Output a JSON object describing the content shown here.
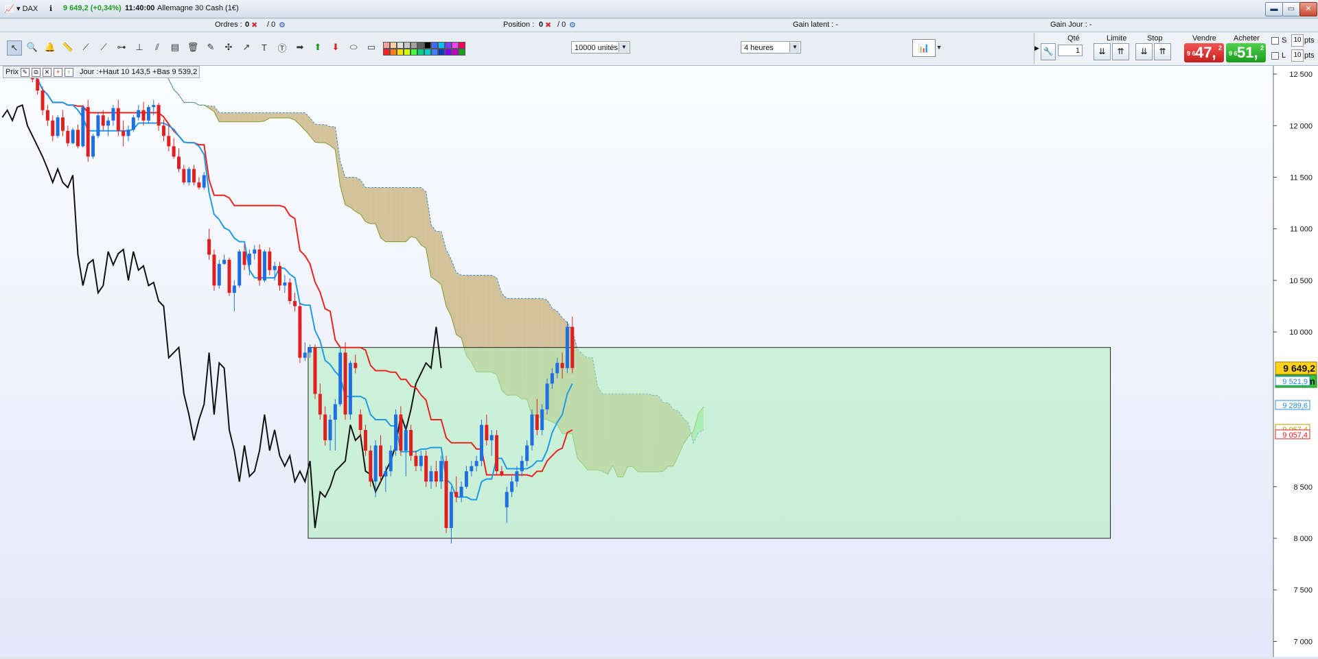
{
  "titlebar": {
    "instrument": "DAX",
    "price_change": "9 649,2 (+0,34%)",
    "time": "11:40:00",
    "market_name": "Allemagne 30 Cash (1€)",
    "window_buttons": [
      "▬",
      "▭",
      "✕"
    ]
  },
  "infobar": {
    "orders_label": "Ordres :",
    "orders_value": "0",
    "orders_sep": "/ 0",
    "position_label": "Position :",
    "position_value": "0",
    "position_sep": "/ 0",
    "latent_label": "Gain latent : -",
    "day_label": "Gain Jour : -"
  },
  "toolbar": {
    "units_select": "10000 unités",
    "period_select": "4 heures"
  },
  "order_panel": {
    "qty_label": "Qté",
    "qty_value": "1",
    "limit_label": "Limite",
    "stop_label": "Stop",
    "sell_label": "Vendre",
    "buy_label": "Acheter",
    "sell_prefix": "9 6",
    "sell_big": "47,",
    "sell_sup": "2",
    "buy_prefix": "9 6",
    "buy_big": "51,",
    "buy_sup": "2",
    "s_label": "S",
    "l_label": "L",
    "s_pts": "10",
    "l_pts": "10",
    "pts_unit": "pts",
    "buy_color": "#23b023",
    "sell_color": "#e03030"
  },
  "legend": {
    "series": "Prix",
    "info": "Jour :+Haut 10 143,5 +Bas 9 539,2"
  },
  "chart_data": {
    "type": "candlestick",
    "y_axis_ticks": [
      "12 500",
      "12 000",
      "11 500",
      "11 000",
      "10 500",
      "10 000",
      "8 500",
      "8 000",
      "7 500",
      "7 000"
    ],
    "ylim": [
      6850,
      12580
    ],
    "price_tag": "9 649,2",
    "timer_tag": "1h20m",
    "tags": [
      {
        "value": "9 521,9",
        "color": "#2a8ce0"
      },
      {
        "value": "9 289,6",
        "color": "#2a8ce0"
      },
      {
        "value": "9 057,4",
        "color": "#b9a000"
      },
      {
        "value": "9 057,4",
        "color": "#e02020"
      }
    ],
    "box": {
      "x_start": 0.242,
      "x_end": 0.872,
      "y_top": 9850,
      "y_bottom": 8000
    },
    "colors": {
      "up": "#1f6fe0",
      "down": "#e02020",
      "tenkan": "#1e9be8",
      "kijun": "#e8221f",
      "chikou": "#111111",
      "cloud_bull": "#8fe98f",
      "cloud_bear": "#c8b07a"
    },
    "candles": [
      [
        12540,
        12580,
        12480,
        12560
      ],
      [
        12560,
        12600,
        12420,
        12450
      ],
      [
        12450,
        12520,
        12300,
        12340
      ],
      [
        12340,
        12380,
        12100,
        12150
      ],
      [
        12150,
        12200,
        12000,
        12050
      ],
      [
        12050,
        12100,
        11850,
        11900
      ],
      [
        11900,
        12100,
        11880,
        12080
      ],
      [
        12080,
        12150,
        11900,
        11950
      ],
      [
        11950,
        12000,
        11800,
        11830
      ],
      [
        11830,
        11980,
        11820,
        11960
      ],
      [
        11960,
        12010,
        11780,
        11800
      ],
      [
        11800,
        12200,
        11790,
        12180
      ],
      [
        12180,
        12250,
        11650,
        11700
      ],
      [
        11700,
        11920,
        11680,
        11900
      ],
      [
        11900,
        12130,
        11880,
        12100
      ],
      [
        12100,
        12150,
        11950,
        12000
      ],
      [
        12000,
        12080,
        11900,
        12050
      ],
      [
        12050,
        12200,
        12000,
        12170
      ],
      [
        12170,
        12250,
        11900,
        11950
      ],
      [
        11950,
        12050,
        11800,
        11900
      ],
      [
        11900,
        12000,
        11850,
        11960
      ],
      [
        11960,
        12100,
        11940,
        12080
      ],
      [
        12080,
        12200,
        12050,
        12150
      ],
      [
        12150,
        12230,
        12000,
        12050
      ],
      [
        12050,
        12200,
        12020,
        12180
      ],
      [
        12180,
        12250,
        12100,
        12200
      ],
      [
        12200,
        12220,
        11950,
        12000
      ],
      [
        12000,
        12060,
        11850,
        11900
      ],
      [
        11900,
        12000,
        11750,
        11800
      ],
      [
        11800,
        11880,
        11680,
        11700
      ],
      [
        11700,
        11780,
        11550,
        11580
      ],
      [
        11580,
        11620,
        11430,
        11450
      ],
      [
        11450,
        11600,
        11420,
        11580
      ],
      [
        11580,
        11620,
        11420,
        11450
      ],
      [
        11450,
        11500,
        11380,
        11400
      ],
      [
        11400,
        11550,
        11380,
        11520
      ],
      [
        10900,
        11000,
        10700,
        10750
      ],
      [
        10750,
        10800,
        10400,
        10450
      ],
      [
        10450,
        10700,
        10420,
        10660
      ],
      [
        10660,
        10750,
        10650,
        10700
      ],
      [
        10700,
        10720,
        10350,
        10380
      ],
      [
        10380,
        10500,
        10200,
        10450
      ],
      [
        10450,
        10800,
        10430,
        10780
      ],
      [
        10780,
        10850,
        10600,
        10650
      ],
      [
        10650,
        10800,
        10550,
        10760
      ],
      [
        10760,
        10840,
        10700,
        10800
      ],
      [
        10800,
        10850,
        10450,
        10500
      ],
      [
        10500,
        10800,
        10480,
        10780
      ],
      [
        10780,
        10820,
        10550,
        10600
      ],
      [
        10600,
        10680,
        10500,
        10640
      ],
      [
        10640,
        10680,
        10400,
        10450
      ],
      [
        10450,
        10550,
        10380,
        10480
      ],
      [
        10480,
        10520,
        10270,
        10300
      ],
      [
        10300,
        10380,
        10200,
        10250
      ],
      [
        10250,
        10280,
        9700,
        9750
      ],
      [
        9750,
        9900,
        9720,
        9800
      ],
      [
        9800,
        9880,
        9750,
        9850
      ],
      [
        9850,
        9880,
        9350,
        9400
      ],
      [
        9400,
        9500,
        9150,
        9200
      ],
      [
        9200,
        9280,
        8900,
        8950
      ],
      [
        8950,
        9200,
        8850,
        9150
      ],
      [
        9150,
        9350,
        8850,
        9300
      ],
      [
        9300,
        9850,
        9280,
        9800
      ],
      [
        9800,
        9900,
        9150,
        9200
      ],
      [
        9200,
        9720,
        9150,
        9700
      ],
      [
        9700,
        9780,
        9600,
        9650
      ],
      [
        9200,
        9250,
        8950,
        9050
      ],
      [
        9050,
        9100,
        8800,
        8850
      ],
      [
        8850,
        8900,
        8500,
        8550
      ],
      [
        8550,
        8950,
        8400,
        8900
      ],
      [
        8900,
        9000,
        8550,
        8600
      ],
      [
        8600,
        8700,
        8450,
        8650
      ],
      [
        8650,
        8900,
        8600,
        8850
      ],
      [
        8850,
        9250,
        8800,
        9200
      ],
      [
        9200,
        9280,
        8800,
        8850
      ],
      [
        8850,
        9100,
        8600,
        9050
      ],
      [
        9050,
        9100,
        8750,
        8800
      ],
      [
        8800,
        8850,
        8650,
        8700
      ],
      [
        8700,
        8850,
        8650,
        8800
      ],
      [
        8800,
        8850,
        8500,
        8550
      ],
      [
        8550,
        8700,
        8480,
        8650
      ],
      [
        8650,
        8750,
        8500,
        8550
      ],
      [
        8550,
        8800,
        8480,
        8750
      ],
      [
        8750,
        8800,
        8050,
        8100
      ],
      [
        8100,
        8500,
        7950,
        8450
      ],
      [
        8450,
        8600,
        8350,
        8400
      ],
      [
        8400,
        8550,
        8350,
        8500
      ],
      [
        8500,
        8700,
        8480,
        8650
      ],
      [
        8650,
        8750,
        8600,
        8700
      ],
      [
        8700,
        8800,
        8650,
        8750
      ],
      [
        8750,
        9150,
        8700,
        9100
      ],
      [
        9100,
        9200,
        8900,
        8950
      ],
      [
        8950,
        9050,
        8800,
        9000
      ],
      [
        9000,
        9050,
        8620,
        8650
      ],
      [
        8650,
        8700,
        8600,
        8620
      ],
      [
        8300,
        8500,
        8150,
        8450
      ],
      [
        8450,
        8600,
        8400,
        8550
      ],
      [
        8550,
        8700,
        8500,
        8650
      ],
      [
        8650,
        8800,
        8600,
        8750
      ],
      [
        8750,
        8950,
        8700,
        8900
      ],
      [
        8900,
        9250,
        8850,
        9200
      ],
      [
        9200,
        9350,
        9000,
        9050
      ],
      [
        9050,
        9300,
        9000,
        9250
      ],
      [
        9250,
        9550,
        9200,
        9500
      ],
      [
        9500,
        9650,
        9450,
        9600
      ],
      [
        9600,
        9750,
        9550,
        9700
      ],
      [
        9700,
        9800,
        9550,
        9650
      ],
      [
        9650,
        10100,
        9600,
        10050
      ],
      [
        10050,
        10150,
        9600,
        9650
      ]
    ]
  }
}
